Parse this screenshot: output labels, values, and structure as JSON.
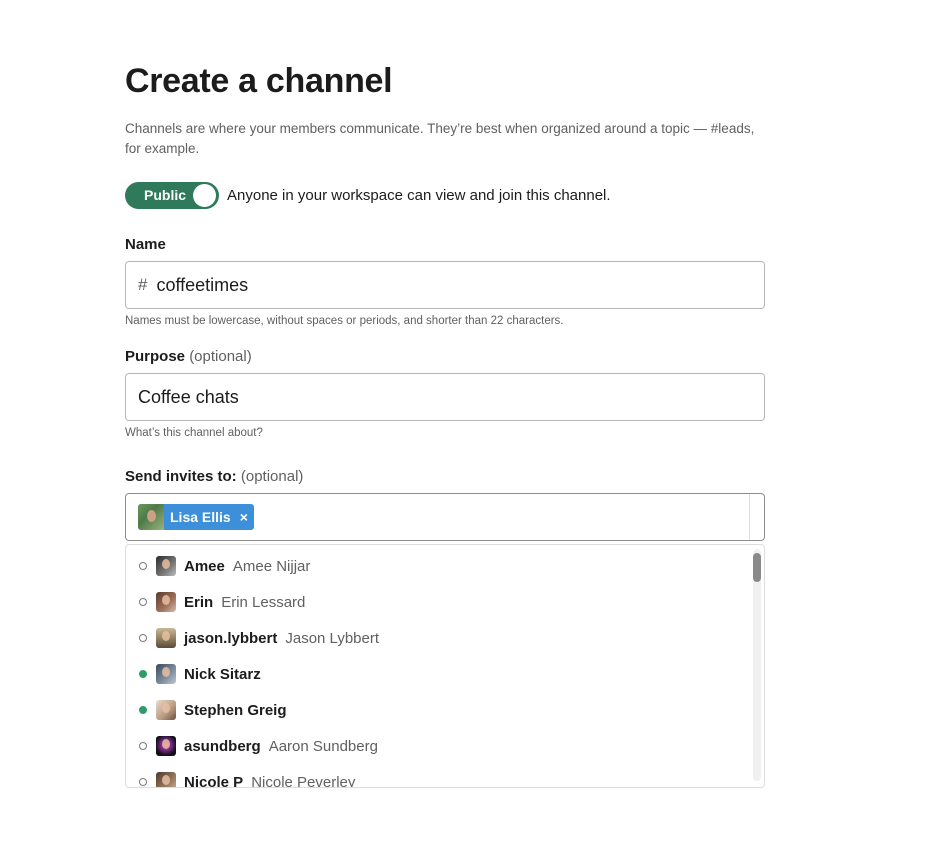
{
  "page": {
    "title": "Create a channel",
    "description": "Channels are where your members communicate. They’re best when organized around a topic — #leads, for example."
  },
  "visibility": {
    "toggle_label": "Public",
    "enabled": true,
    "description": "Anyone in your workspace can view and join this channel."
  },
  "name_field": {
    "label": "Name",
    "prefix": "#",
    "value": "coffeetimes",
    "hint": "Names must be lowercase, without spaces or periods, and shorter than 22 characters."
  },
  "purpose_field": {
    "label": "Purpose",
    "optional": "(optional)",
    "value": "Coffee chats",
    "hint": "What’s this channel about?"
  },
  "invites": {
    "label": "Send invites to:",
    "optional": "(optional)",
    "selected": [
      {
        "name": "Lisa Ellis",
        "remove_icon": "×"
      }
    ],
    "suggestions": [
      {
        "username": "Amee",
        "real_name": "Amee Nijjar",
        "active": false
      },
      {
        "username": "Erin",
        "real_name": "Erin Lessard",
        "active": false
      },
      {
        "username": "jason.lybbert",
        "real_name": "Jason Lybbert",
        "active": false
      },
      {
        "username": "Nick Sitarz",
        "real_name": "",
        "active": true
      },
      {
        "username": "Stephen Greig",
        "real_name": "",
        "active": true
      },
      {
        "username": "asundberg",
        "real_name": "Aaron Sundberg",
        "active": false
      },
      {
        "username": "Nicole P",
        "real_name": "Nicole Peverley",
        "active": false
      }
    ]
  },
  "colors": {
    "toggle_on": "#2f7a5a",
    "chip": "#3e8fd9",
    "active_status": "#2f9a6a"
  }
}
